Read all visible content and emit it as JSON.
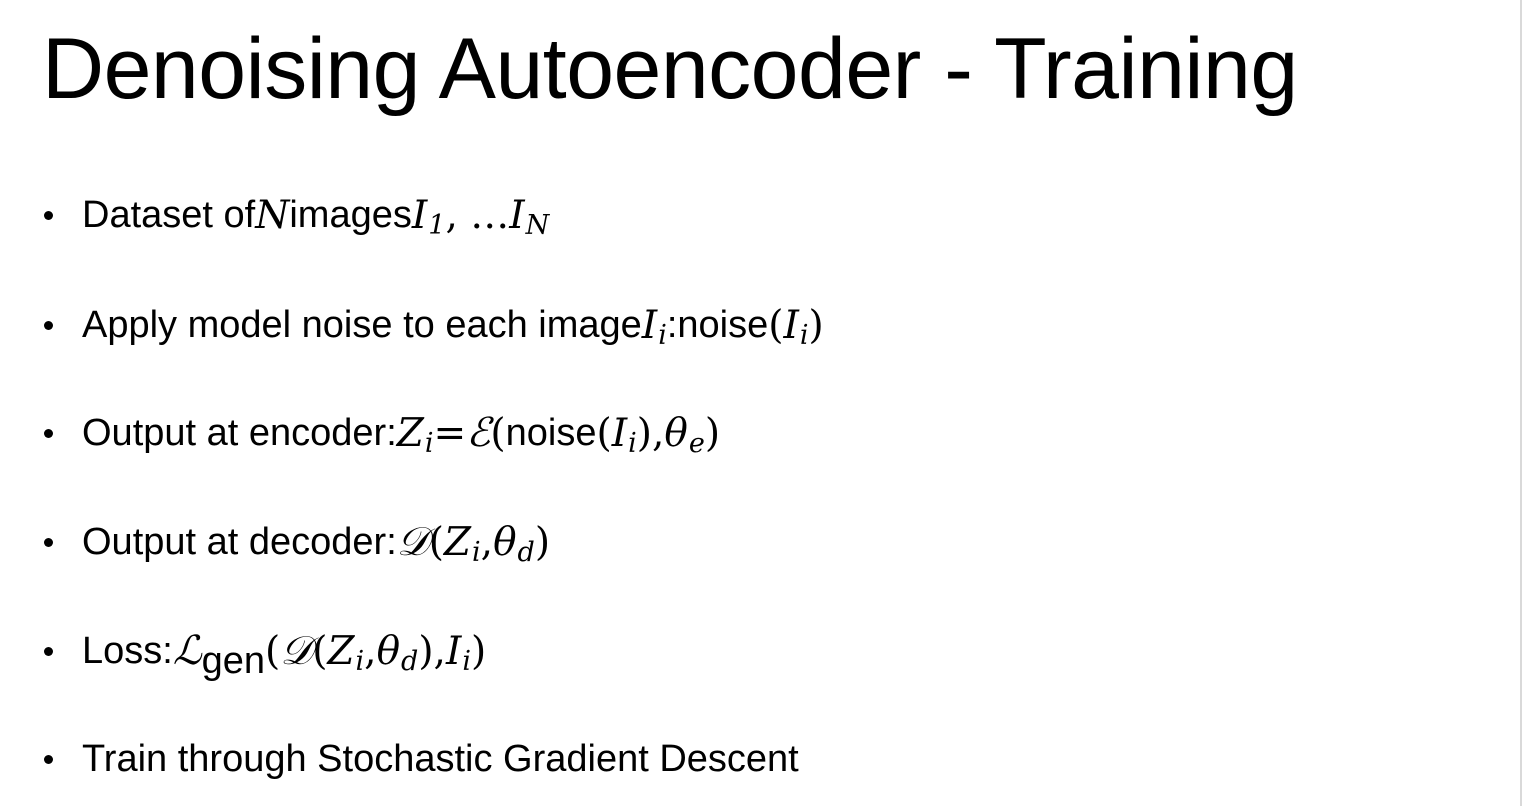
{
  "slide": {
    "title": "Denoising Autoencoder - Training",
    "bullets": [
      {
        "prefix": "Dataset of ",
        "var_n": "N",
        "middle": " images ",
        "i1": "I",
        "sub1": "1",
        "dots": ", …",
        "in": "I",
        "subn": "N"
      },
      {
        "prefix": "Apply model noise to each image ",
        "ii": "I",
        "subi": "i",
        "colon": ": ",
        "noise": "noise",
        "open": "(",
        "arg": "I",
        "argsub": "i",
        "close": ")"
      },
      {
        "prefix": "Output at encoder: ",
        "z": "Z",
        "zsub": "i",
        "eq": " = ",
        "enc": "ℰ",
        "open": "(",
        "noise": "noise",
        "arg_open": "(",
        "arg": "I",
        "argsub": "i",
        "arg_close": "), ",
        "theta": "θ",
        "thetasub": "e",
        "close": ")"
      },
      {
        "prefix": "Output at decoder: ",
        "dec": "𝒟",
        "open": "(",
        "z": "Z",
        "zsub": "i",
        "comma": ", ",
        "theta": "θ",
        "thetasub": "d",
        "close": ")"
      },
      {
        "prefix": "Loss: ",
        "loss": "ℒ",
        "losssub": "gen",
        "open": "(",
        "dec": "𝒟",
        "inner_open": "(",
        "z": "Z",
        "zsub": "i",
        "comma": ", ",
        "theta": "θ",
        "thetasub": "d",
        "inner_close": "), ",
        "i": "I",
        "isub": "i",
        "close": ")"
      },
      {
        "text": "Train through Stochastic Gradient Descent"
      }
    ]
  }
}
